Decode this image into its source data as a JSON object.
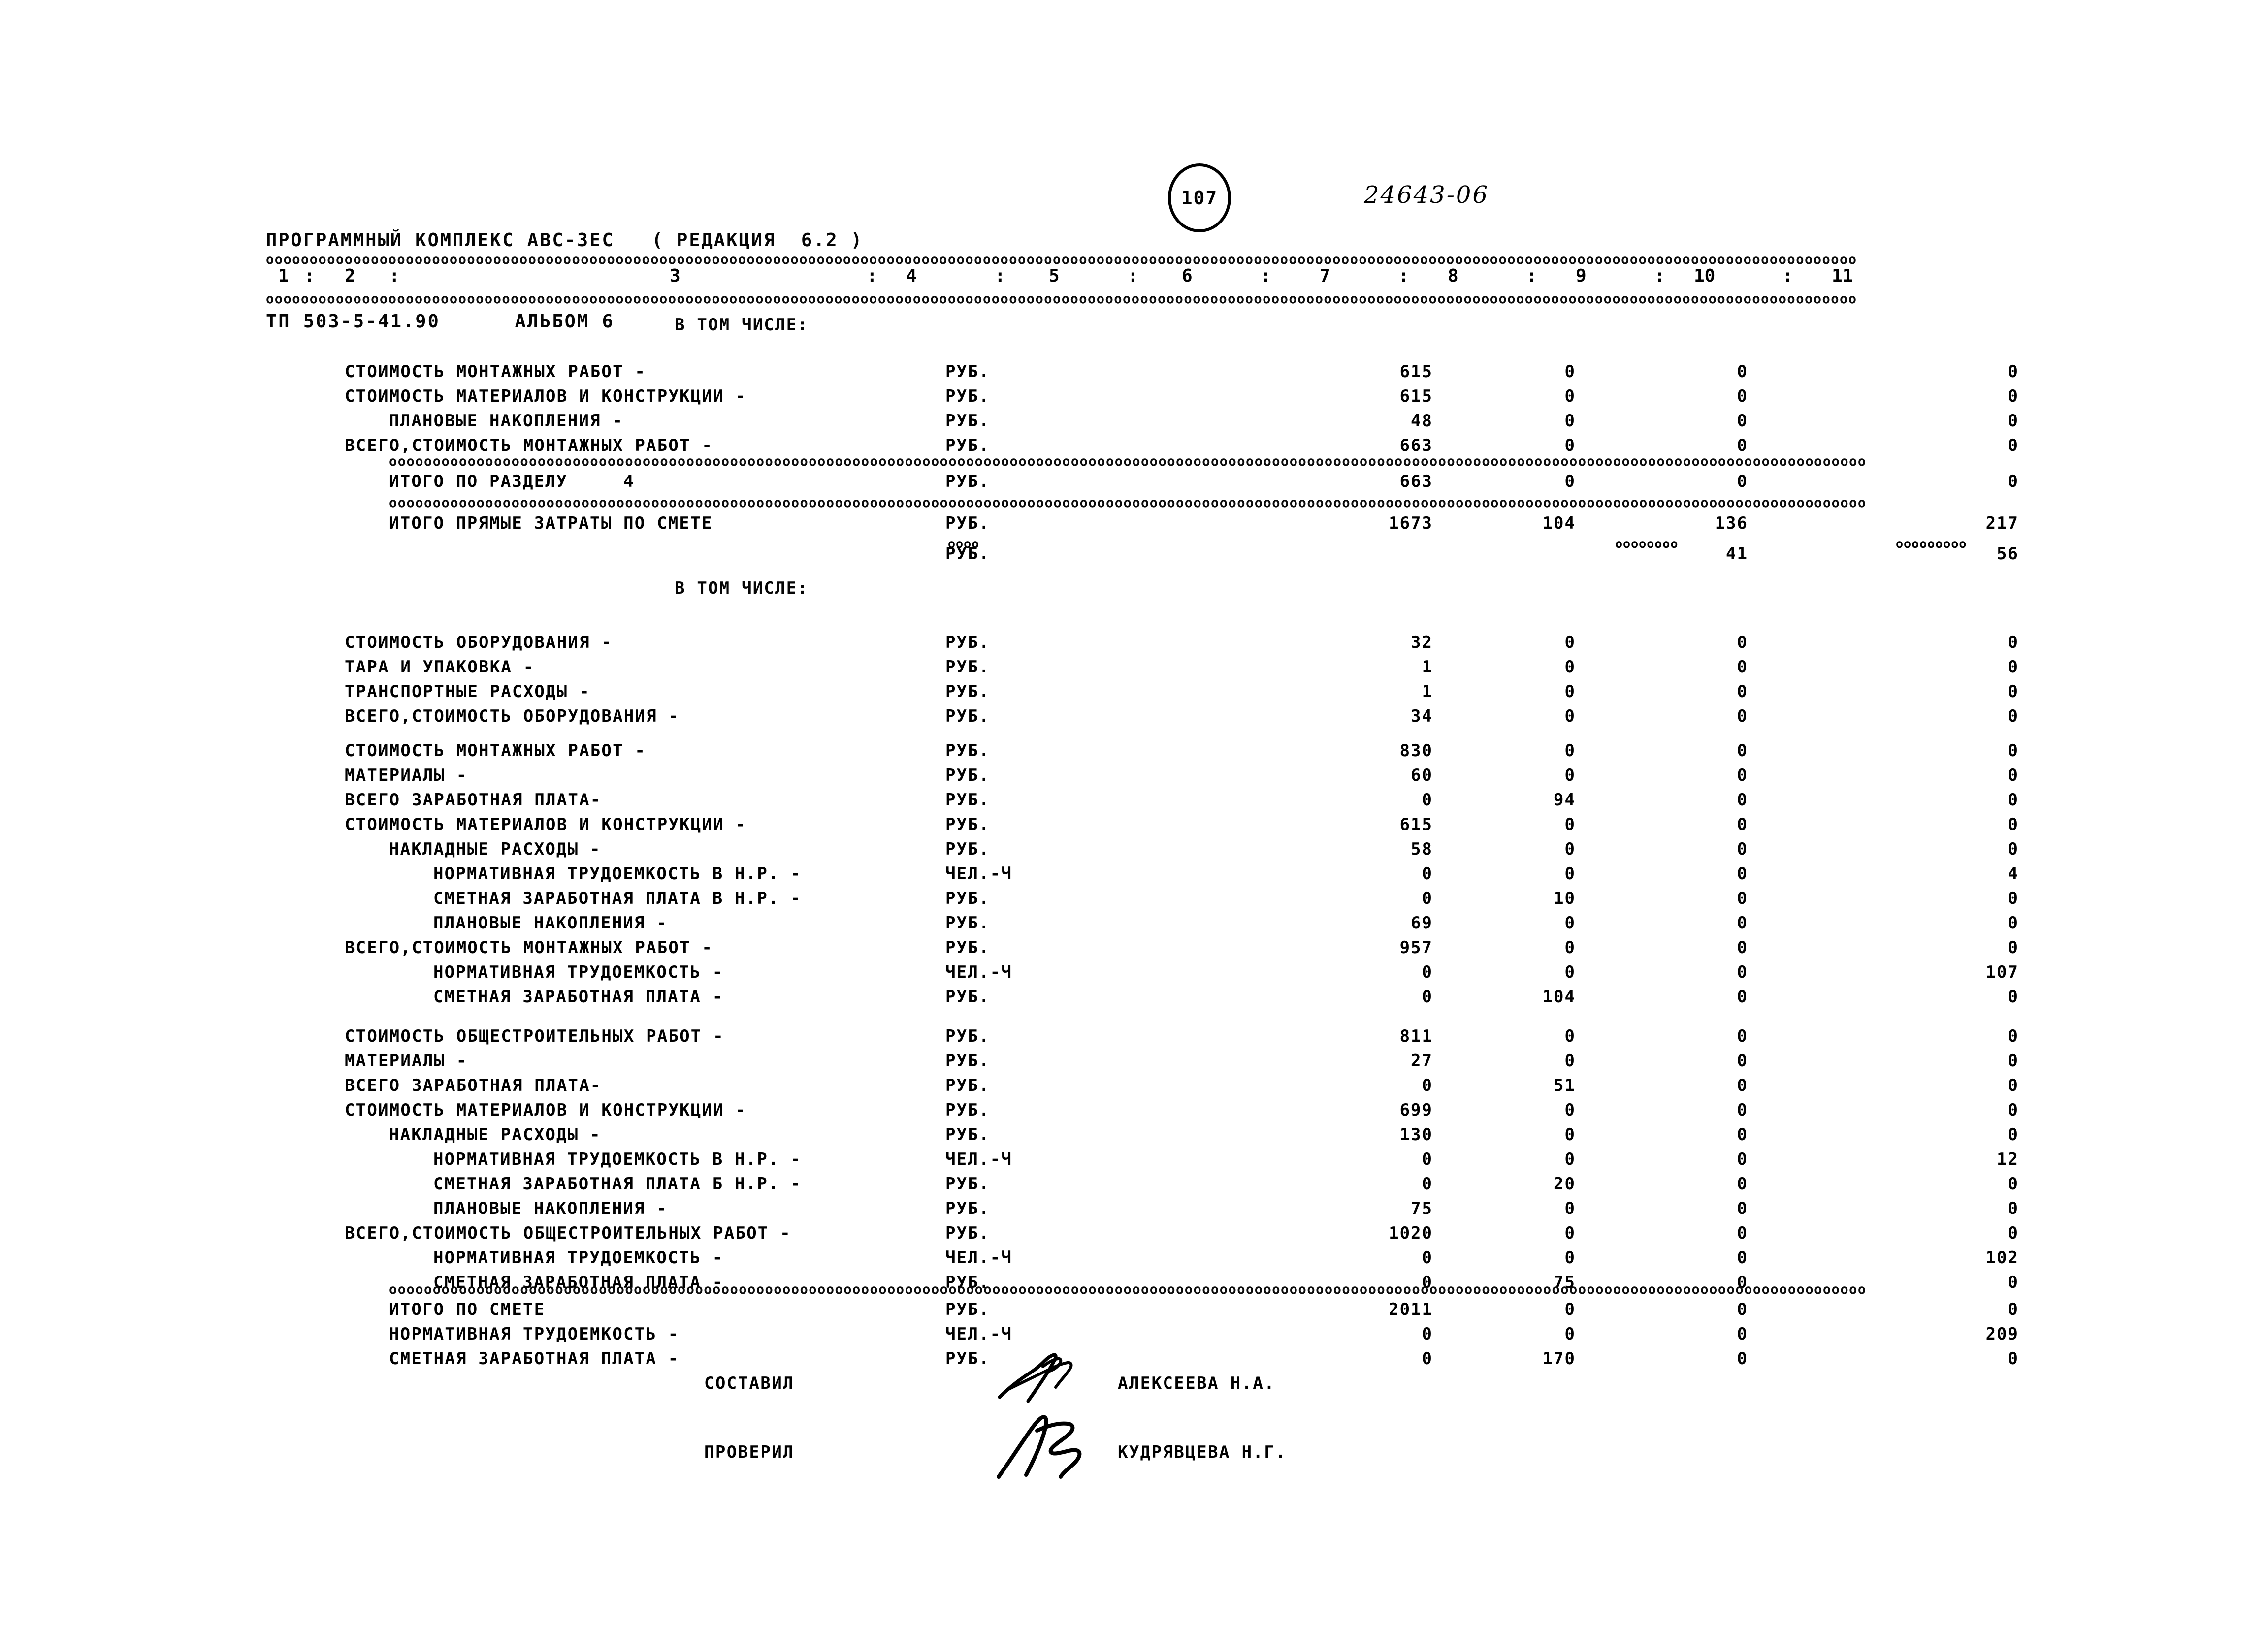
{
  "header": {
    "line1": "ПРОГРАММНЫЙ КОМПЛЕКС АВС-3ЕС   ( РЕДАКЦИЯ  6.2 )",
    "line2": "ТП 503-5-41.90      АЛЬБОМ 6",
    "page_number": "107",
    "doc_code": "24643-06"
  },
  "columns": {
    "labels": [
      "1",
      "2",
      "3",
      "4",
      "5",
      "6",
      "7",
      "8",
      "9",
      "10",
      "11"
    ],
    "separator": ":"
  },
  "section_headings": {
    "vtom1": "В ТОМ ЧИСЛЕ:",
    "vtom2": "В ТОМ ЧИСЛЕ:"
  },
  "units": {
    "rub": "РУБ.",
    "chel_ch": "ЧЕЛ.-Ч"
  },
  "rows": [
    {
      "label": "СТОИМОСТЬ МОНТАЖНЫХ РАБОТ -",
      "indent": 0,
      "unit": "РУБ.",
      "c7": "615",
      "c8": "0",
      "c9": "0",
      "c11": "0"
    },
    {
      "label": "СТОИМОСТЬ МАТЕРИАЛОВ И КОНСТРУКЦИИ -",
      "indent": 0,
      "unit": "РУБ.",
      "c7": "615",
      "c8": "0",
      "c9": "0",
      "c11": "0"
    },
    {
      "label": "ПЛАНОВЫЕ НАКОПЛЕНИЯ -",
      "indent": 1,
      "unit": "РУБ.",
      "c7": "48",
      "c8": "0",
      "c9": "0",
      "c11": "0"
    },
    {
      "label": "ВСЕГО,СТОИМОСТЬ МОНТАЖНЫХ РАБОТ -",
      "indent": 0,
      "unit": "РУБ.",
      "c7": "663",
      "c8": "0",
      "c9": "0",
      "c11": "0"
    },
    {
      "label": "ИТОГО ПО РАЗДЕЛУ     4",
      "indent": 1,
      "unit": "РУБ.",
      "c7": "663",
      "c8": "0",
      "c9": "0",
      "c11": "0"
    },
    {
      "label": "ИТОГО ПРЯМЫЕ ЗАТРАТЫ ПО СМЕТЕ",
      "indent": 1,
      "unit": "РУБ.",
      "c7": "1673",
      "c8": "104",
      "c9": "136",
      "c11": "217"
    },
    {
      "label": "",
      "indent": 1,
      "unit": "РУБ.",
      "c7": "",
      "c8": "",
      "c9": "41",
      "c11": "56"
    },
    {
      "label": "СТОИМОСТЬ ОБОРУДОВАНИЯ -",
      "indent": 0,
      "unit": "РУБ.",
      "c7": "32",
      "c8": "0",
      "c9": "0",
      "c11": "0"
    },
    {
      "label": "ТАРА И УПАКОВКА -",
      "indent": 0,
      "unit": "РУБ.",
      "c7": "1",
      "c8": "0",
      "c9": "0",
      "c11": "0"
    },
    {
      "label": "ТРАНСПОРТНЫЕ РАСХОДЫ -",
      "indent": 0,
      "unit": "РУБ.",
      "c7": "1",
      "c8": "0",
      "c9": "0",
      "c11": "0"
    },
    {
      "label": "ВСЕГО,СТОИМОСТЬ ОБОРУДОВАНИЯ -",
      "indent": 0,
      "unit": "РУБ.",
      "c7": "34",
      "c8": "0",
      "c9": "0",
      "c11": "0"
    },
    {
      "label": "СТОИМОСТЬ МОНТАЖНЫХ РАБОТ -",
      "indent": 0,
      "unit": "РУБ.",
      "c7": "830",
      "c8": "0",
      "c9": "0",
      "c11": "0"
    },
    {
      "label": "МАТЕРИАЛЫ -",
      "indent": 0,
      "unit": "РУБ.",
      "c7": "60",
      "c8": "0",
      "c9": "0",
      "c11": "0"
    },
    {
      "label": "ВСЕГО ЗАРАБОТНАЯ ПЛАТА-",
      "indent": 0,
      "unit": "РУБ.",
      "c7": "0",
      "c8": "94",
      "c9": "0",
      "c11": "0"
    },
    {
      "label": "СТОИМОСТЬ МАТЕРИАЛОВ И КОНСТРУКЦИИ -",
      "indent": 0,
      "unit": "РУБ.",
      "c7": "615",
      "c8": "0",
      "c9": "0",
      "c11": "0"
    },
    {
      "label": "НАКЛАДНЫЕ РАСХОДЫ -",
      "indent": 1,
      "unit": "РУБ.",
      "c7": "58",
      "c8": "0",
      "c9": "0",
      "c11": "0"
    },
    {
      "label": "НОРМАТИВНАЯ ТРУДОЕМКОСТЬ В Н.Р. -",
      "indent": 2,
      "unit": "ЧЕЛ.-Ч",
      "c7": "0",
      "c8": "0",
      "c9": "0",
      "c11": "4"
    },
    {
      "label": "СМЕТНАЯ ЗАРАБОТНАЯ ПЛАТА В Н.Р. -",
      "indent": 2,
      "unit": "РУБ.",
      "c7": "0",
      "c8": "10",
      "c9": "0",
      "c11": "0"
    },
    {
      "label": "ПЛАНОВЫЕ НАКОПЛЕНИЯ -",
      "indent": 2,
      "unit": "РУБ.",
      "c7": "69",
      "c8": "0",
      "c9": "0",
      "c11": "0"
    },
    {
      "label": "ВСЕГО,СТОИМОСТЬ МОНТАЖНЫХ РАБОТ -",
      "indent": 0,
      "unit": "РУБ.",
      "c7": "957",
      "c8": "0",
      "c9": "0",
      "c11": "0"
    },
    {
      "label": "НОРМАТИВНАЯ ТРУДОЕМКОСТЬ -",
      "indent": 2,
      "unit": "ЧЕЛ.-Ч",
      "c7": "0",
      "c8": "0",
      "c9": "0",
      "c11": "107"
    },
    {
      "label": "СМЕТНАЯ ЗАРАБОТНАЯ ПЛАТА -",
      "indent": 2,
      "unit": "РУБ.",
      "c7": "0",
      "c8": "104",
      "c9": "0",
      "c11": "0"
    },
    {
      "label": "СТОИМОСТЬ ОБЩЕСТРОИТЕЛЬНЫХ РАБОТ -",
      "indent": 0,
      "unit": "РУБ.",
      "c7": "811",
      "c8": "0",
      "c9": "0",
      "c11": "0"
    },
    {
      "label": "МАТЕРИАЛЫ -",
      "indent": 0,
      "unit": "РУБ.",
      "c7": "27",
      "c8": "0",
      "c9": "0",
      "c11": "0"
    },
    {
      "label": "ВСЕГО ЗАРАБОТНАЯ ПЛАТА-",
      "indent": 0,
      "unit": "РУБ.",
      "c7": "0",
      "c8": "51",
      "c9": "0",
      "c11": "0"
    },
    {
      "label": "СТОИМОСТЬ МАТЕРИАЛОВ И КОНСТРУКЦИИ -",
      "indent": 0,
      "unit": "РУБ.",
      "c7": "699",
      "c8": "0",
      "c9": "0",
      "c11": "0"
    },
    {
      "label": "НАКЛАДНЫЕ РАСХОДЫ -",
      "indent": 1,
      "unit": "РУБ.",
      "c7": "130",
      "c8": "0",
      "c9": "0",
      "c11": "0"
    },
    {
      "label": "НОРМАТИВНАЯ ТРУДОЕМКОСТЬ В Н.Р. -",
      "indent": 2,
      "unit": "ЧЕЛ.-Ч",
      "c7": "0",
      "c8": "0",
      "c9": "0",
      "c11": "12"
    },
    {
      "label": "СМЕТНАЯ ЗАРАБОТНАЯ ПЛАТА Б Н.Р. -",
      "indent": 2,
      "unit": "РУБ.",
      "c7": "0",
      "c8": "20",
      "c9": "0",
      "c11": "0"
    },
    {
      "label": "ПЛАНОВЫЕ НАКОПЛЕНИЯ -",
      "indent": 2,
      "unit": "РУБ.",
      "c7": "75",
      "c8": "0",
      "c9": "0",
      "c11": "0"
    },
    {
      "label": "ВСЕГО,СТОИМОСТЬ ОБЩЕСТРОИТЕЛЬНЫХ РАБОТ -",
      "indent": 0,
      "unit": "РУБ.",
      "c7": "1020",
      "c8": "0",
      "c9": "0",
      "c11": "0"
    },
    {
      "label": "НОРМАТИВНАЯ ТРУДОЕМКОСТЬ -",
      "indent": 2,
      "unit": "ЧЕЛ.-Ч",
      "c7": "0",
      "c8": "0",
      "c9": "0",
      "c11": "102"
    },
    {
      "label": "СМЕТНАЯ ЗАРАБОТНАЯ ПЛАТА -",
      "indent": 2,
      "unit": "РУБ.",
      "c7": "0",
      "c8": "75",
      "c9": "0",
      "c11": "0"
    },
    {
      "label": "ИТОГО ПО СМЕТЕ",
      "indent": 1,
      "unit": "РУБ.",
      "c7": "2011",
      "c8": "0",
      "c9": "0",
      "c11": "0"
    },
    {
      "label": "НОРМАТИВНАЯ ТРУДОЕМКОСТЬ -",
      "indent": 1,
      "unit": "ЧЕЛ.-Ч",
      "c7": "0",
      "c8": "0",
      "c9": "0",
      "c11": "209"
    },
    {
      "label": "СМЕТНАЯ ЗАРАБОТНАЯ ПЛАТА -",
      "indent": 1,
      "unit": "РУБ.",
      "c7": "0",
      "c8": "170",
      "c9": "0",
      "c11": "0"
    }
  ],
  "signatures": {
    "composer_role": "СОСТАВИЛ",
    "composer_name": "АЛЕКСЕЕВА Н.А.",
    "checker_role": "ПРОВЕРИЛ",
    "checker_name": "КУДРЯВЦЕВА Н.Г."
  }
}
